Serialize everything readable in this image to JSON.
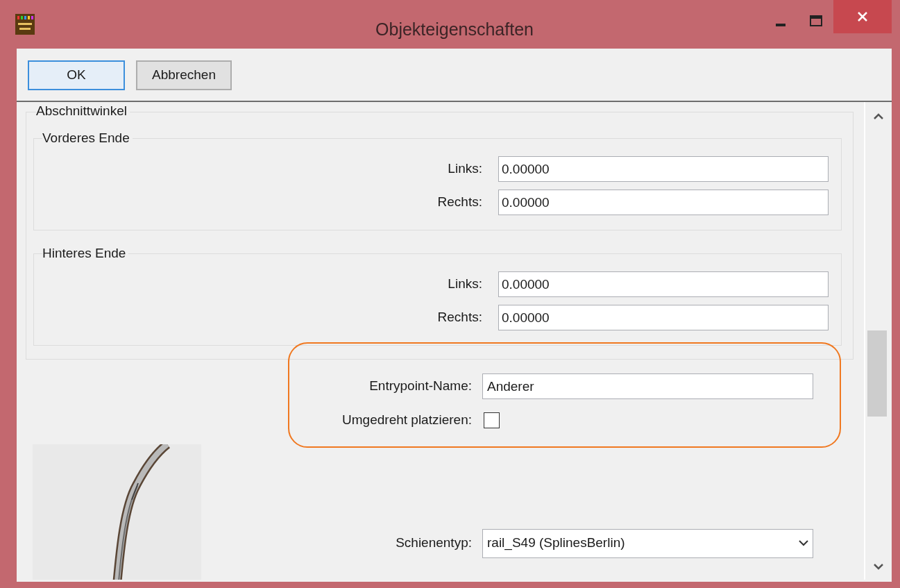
{
  "window": {
    "title": "Objekteigenschaften"
  },
  "toolbar": {
    "buttons": [
      {
        "label": "OK",
        "selected": true
      },
      {
        "label": "Abbrechen",
        "selected": false
      }
    ]
  },
  "section": {
    "title": "Abschnittwinkel",
    "groups": [
      {
        "title": "Vorderes Ende",
        "fields": [
          {
            "label": "Links:",
            "value": "0.00000"
          },
          {
            "label": "Rechts:",
            "value": "0.00000"
          }
        ]
      },
      {
        "title": "Hinteres Ende",
        "fields": [
          {
            "label": "Links:",
            "value": "0.00000"
          },
          {
            "label": "Rechts:",
            "value": "0.00000"
          }
        ]
      }
    ]
  },
  "entrypoint": {
    "name_label": "Entrypoint-Name:",
    "name_value": "Anderer",
    "reverse_label": "Umgedreht platzieren:",
    "reverse_checked": false
  },
  "rail": {
    "label": "Schienentyp:",
    "value": "rail_S49 (SplinesBerlin)"
  }
}
